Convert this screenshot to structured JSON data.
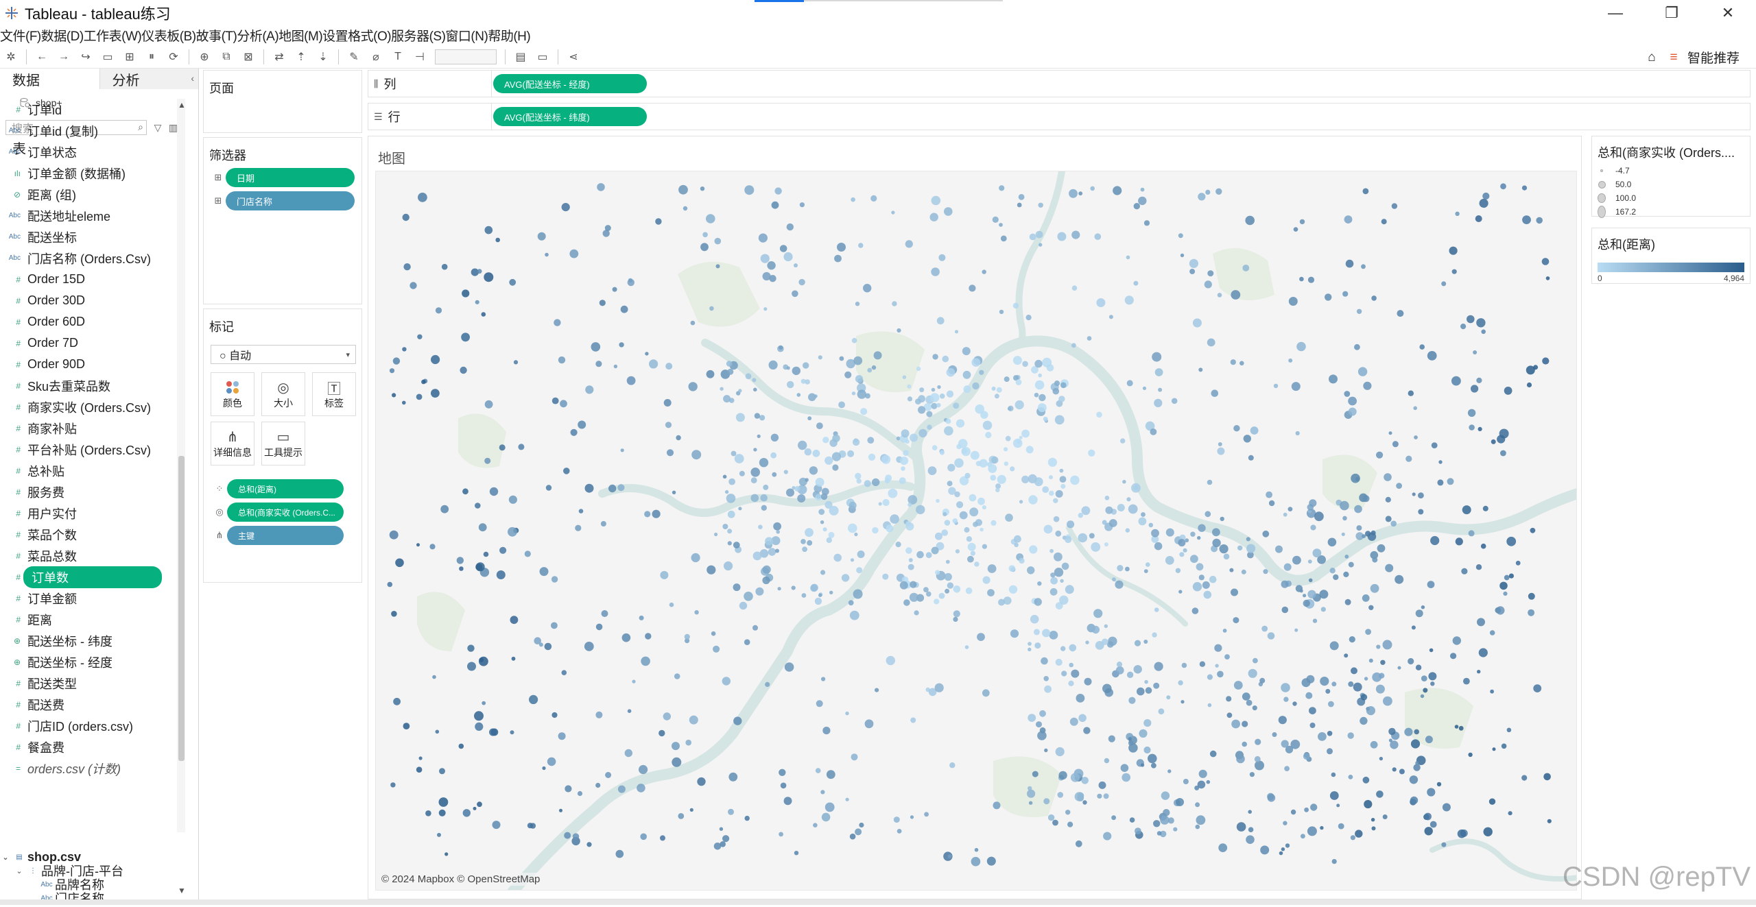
{
  "window": {
    "title": "Tableau - tableau练习",
    "minimize": "—",
    "restore": "❐",
    "close": "✕"
  },
  "menu": [
    "文件(F)",
    "数据(D)",
    "工作表(W)",
    "仪表板(B)",
    "故事(T)",
    "分析(A)",
    "地图(M)",
    "设置格式(O)",
    "服务器(S)",
    "窗口(N)",
    "帮助(H)"
  ],
  "toolbar": {
    "smart_label": "智能推荐"
  },
  "left_pane": {
    "tab_data": "数据",
    "tab_analysis": "分析",
    "collapse": "‹",
    "datasource": "shop+",
    "search_placeholder": "搜索",
    "section_table": "表",
    "fields": [
      {
        "icon": "#",
        "type": "num",
        "name": "订单id"
      },
      {
        "icon": "Abc",
        "type": "abc",
        "name": "订单id (复制)"
      },
      {
        "icon": "Abc",
        "type": "abc",
        "name": "订单状态"
      },
      {
        "icon": "ılı",
        "type": "num",
        "name": "订单金额 (数据桶)"
      },
      {
        "icon": "⊘",
        "type": "num",
        "name": "距离 (组)"
      },
      {
        "icon": "Abc",
        "type": "abc",
        "name": "配送地址eleme"
      },
      {
        "icon": "Abc",
        "type": "abc",
        "name": "配送坐标"
      },
      {
        "icon": "Abc",
        "type": "abc",
        "name": "门店名称 (Orders.Csv)"
      },
      {
        "icon": "#",
        "type": "num",
        "name": "Order 15D"
      },
      {
        "icon": "#",
        "type": "num",
        "name": "Order 30D"
      },
      {
        "icon": "#",
        "type": "num",
        "name": "Order 60D"
      },
      {
        "icon": "#",
        "type": "num",
        "name": "Order 7D"
      },
      {
        "icon": "#",
        "type": "num",
        "name": "Order 90D"
      },
      {
        "icon": "#",
        "type": "num",
        "name": "Sku去重菜品数"
      },
      {
        "icon": "#",
        "type": "num",
        "name": "商家实收 (Orders.Csv)"
      },
      {
        "icon": "#",
        "type": "num",
        "name": "商家补贴"
      },
      {
        "icon": "#",
        "type": "num",
        "name": "平台补贴 (Orders.Csv)"
      },
      {
        "icon": "#",
        "type": "num",
        "name": "总补贴"
      },
      {
        "icon": "#",
        "type": "num",
        "name": "服务费"
      },
      {
        "icon": "#",
        "type": "num",
        "name": "用户实付"
      },
      {
        "icon": "#",
        "type": "num",
        "name": "菜品个数"
      },
      {
        "icon": "#",
        "type": "num",
        "name": "菜品总数"
      },
      {
        "icon": "#",
        "type": "num",
        "name": "订单数",
        "active": true
      },
      {
        "icon": "#",
        "type": "num",
        "name": "订单金额"
      },
      {
        "icon": "#",
        "type": "num",
        "name": "距离"
      },
      {
        "icon": "⊕",
        "type": "globe",
        "name": "配送坐标 - 纬度"
      },
      {
        "icon": "⊕",
        "type": "globe",
        "name": "配送坐标 - 经度"
      },
      {
        "icon": "#",
        "type": "num",
        "name": "配送类型"
      },
      {
        "icon": "#",
        "type": "num",
        "name": "配送费"
      },
      {
        "icon": "#",
        "type": "num",
        "name": "门店ID (orders.csv)"
      },
      {
        "icon": "#",
        "type": "num",
        "name": "餐盒费"
      },
      {
        "icon": "=",
        "type": "num",
        "name": "orders.csv (计数)",
        "italic": true
      }
    ],
    "tree": [
      {
        "caret": "⌄",
        "icon": "▤",
        "name": "shop.csv",
        "bold": true,
        "indent": 0
      },
      {
        "caret": "⌄",
        "icon": "⋮",
        "name": "品牌-门店-平台",
        "indent": 20
      },
      {
        "caret": "",
        "icon": "Abc",
        "name": "品牌名称",
        "indent": 40
      },
      {
        "caret": "",
        "icon": "Abc",
        "name": "门店名称",
        "indent": 40
      }
    ]
  },
  "pages": {
    "title": "页面"
  },
  "filters": {
    "title": "筛选器",
    "items": [
      "日期",
      "门店名称"
    ]
  },
  "marks": {
    "title": "标记",
    "type": "○ 自动",
    "buttons": {
      "color": "颜色",
      "size": "大小",
      "label": "标签",
      "detail": "详细信息",
      "tooltip": "工具提示"
    },
    "pills": [
      "总和(距离)",
      "总和(商家实收 (Orders.C...",
      "主键"
    ]
  },
  "columns": {
    "label": "列",
    "pill": "AVG(配送坐标 - 经度)"
  },
  "rows": {
    "label": "行",
    "pill": "AVG(配送坐标 - 纬度)"
  },
  "viz": {
    "title": "地图",
    "attribution": "© 2024 Mapbox © OpenStreetMap"
  },
  "legend_size": {
    "title": "总和(商家实收 (Orders....",
    "items": [
      "-4.7",
      "50.0",
      "100.0",
      "167.2"
    ]
  },
  "legend_color": {
    "title": "总和(距离)",
    "min": "0",
    "max": "4,964",
    "color_low": "#b9dcf3",
    "color_high": "#2a5d8c"
  },
  "watermark": "CSDN @repTV"
}
